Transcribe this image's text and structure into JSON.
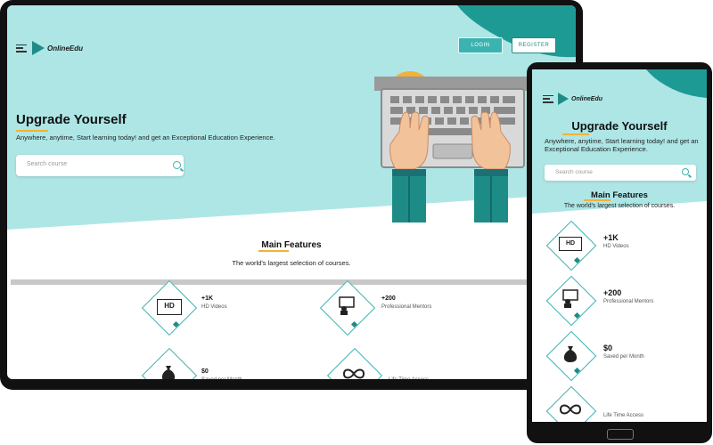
{
  "brand": {
    "name": "OnlineEdu"
  },
  "nav": {
    "login_label": "LOGIN",
    "register_label": "REGISTER"
  },
  "hero": {
    "headline": "Upgrade Yourself",
    "subtitle": "Anywhere, anytime, Start learning today! and get an Exceptional Education Experience.",
    "search_placeholder": "Search course"
  },
  "features": {
    "title": "Main Features",
    "subtitle": "The world's largest selection of courses.",
    "items": [
      {
        "value": "+1K",
        "label": "HD Videos",
        "icon": "hd-video-icon"
      },
      {
        "value": "+200",
        "label": "Professional Mentors",
        "icon": "mentor-icon"
      },
      {
        "value": "$0",
        "label": "Saved per Month",
        "icon": "money-bag-icon"
      },
      {
        "value": "",
        "label": "Life Time Access",
        "icon": "infinity-icon"
      }
    ]
  },
  "colors": {
    "teal_light": "#aee6e6",
    "teal_dark": "#1e8c86",
    "accent": "#3bb3b0",
    "underline": "#f2b237",
    "skin": "#f2c39b"
  }
}
